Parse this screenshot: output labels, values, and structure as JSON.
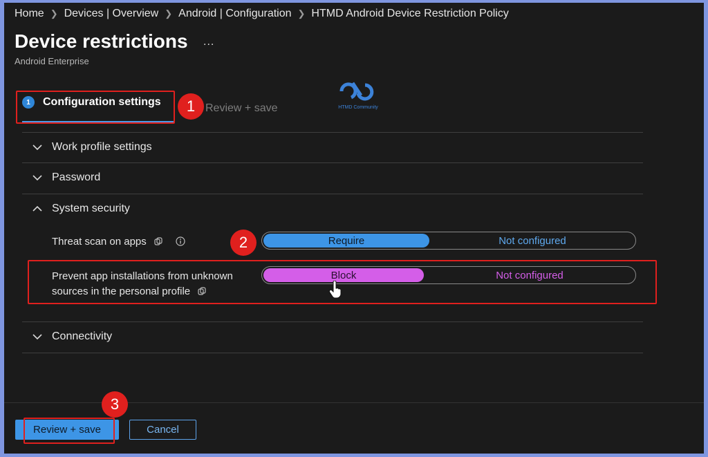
{
  "breadcrumb": [
    "Home",
    "Devices | Overview",
    "Android | Configuration",
    "HTMD Android Device Restriction Policy"
  ],
  "header": {
    "title": "Device restrictions",
    "more": "...",
    "subtitle": "Android Enterprise"
  },
  "wizard": {
    "active_step_number": "1",
    "active_step_label": "Configuration settings",
    "next_step_label": "Review + save"
  },
  "logo": {
    "text": "HTMD Community"
  },
  "sections": {
    "work_profile": "Work profile settings",
    "password": "Password",
    "system_security": "System security",
    "connectivity": "Connectivity"
  },
  "settings": {
    "threat_scan": {
      "label": "Threat scan on apps",
      "selected": "Require",
      "other": "Not configured"
    },
    "prevent_unknown": {
      "label_line1": "Prevent app installations from unknown",
      "label_line2": "sources in the personal profile",
      "selected": "Block",
      "other": "Not configured"
    }
  },
  "annotations": {
    "one": "1",
    "two": "2",
    "three": "3"
  },
  "footer": {
    "review_save": "Review + save",
    "cancel": "Cancel"
  },
  "colors": {
    "accent_blue": "#3d95e6",
    "block_pink": "#d45ee8",
    "annotation_red": "#e0201e"
  }
}
